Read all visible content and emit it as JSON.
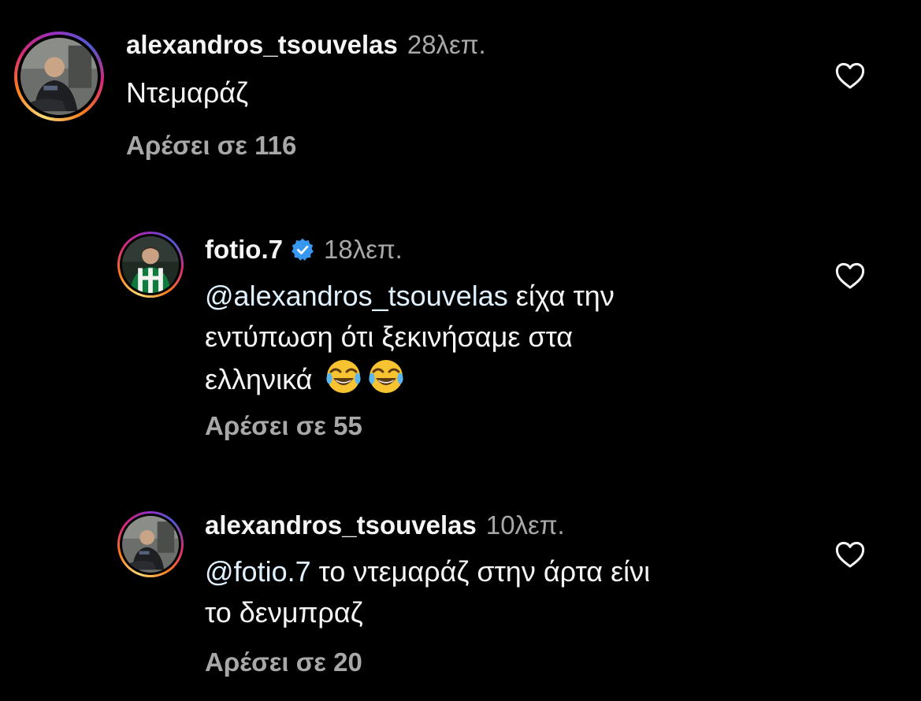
{
  "comments": [
    {
      "username": "alexandros_tsouvelas",
      "time": "28λεπ.",
      "verified": false,
      "text": "Ντεμαράζ",
      "likes": "Αρέσει σε 116"
    },
    {
      "username": "fotio.7",
      "time": "18λεπ.",
      "verified": true,
      "mention": "@alexandros_tsouvelas",
      "text_line1_rest": " είχα την",
      "text_line2": "εντύπωση ότι ξεκινήσαμε στα",
      "text_line3": "ελληνικά",
      "likes": "Αρέσει σε 55"
    },
    {
      "username": "alexandros_tsouvelas",
      "time": "10λεπ.",
      "verified": false,
      "mention": "@fotio.7",
      "text_line1_rest": " το ντεμαράζ στην άρτα είνι",
      "text_line2": "το δενμπραζ",
      "likes": "Αρέσει σε 20"
    }
  ],
  "icons": {
    "like": "heart-outline-icon",
    "verified": "verified-badge-icon",
    "emoji": "face-with-tears-of-joy-emoji"
  },
  "colors": {
    "background": "#000000",
    "text": "#f5f5f5",
    "secondary": "#a8a8a8",
    "verified_blue": "#3897f0",
    "mention": "#e0f1ff"
  }
}
